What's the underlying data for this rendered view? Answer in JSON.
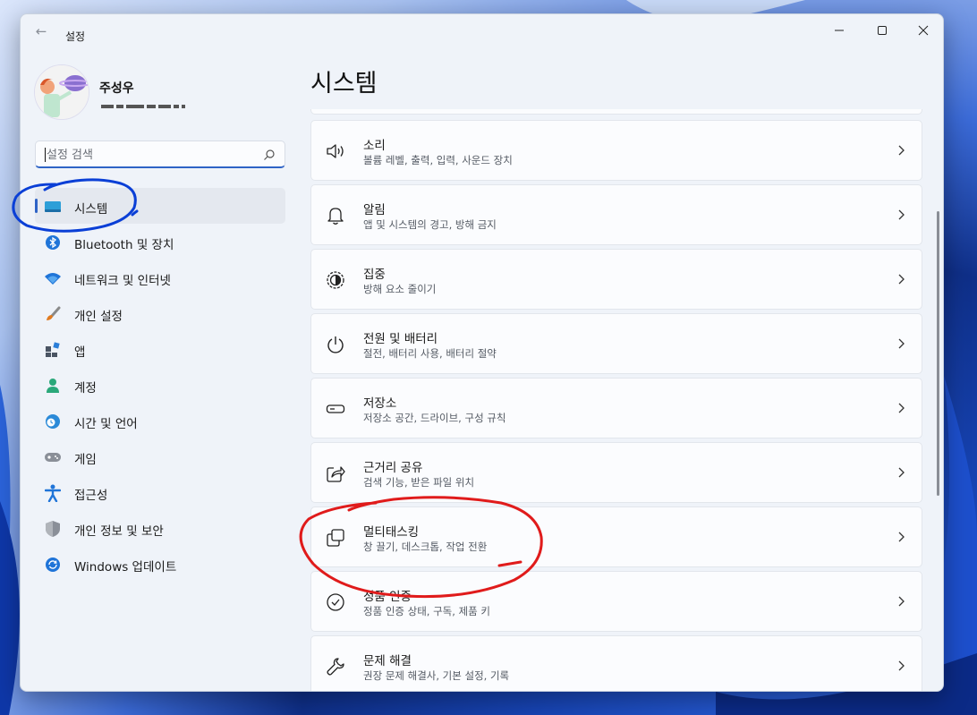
{
  "window": {
    "app_title": "설정",
    "back_label": "←"
  },
  "profile": {
    "name": "주성우"
  },
  "search": {
    "placeholder": "설정 검색"
  },
  "nav": {
    "items": [
      {
        "label": "시스템",
        "icon": "system-icon",
        "selected": true
      },
      {
        "label": "Bluetooth 및 장치",
        "icon": "bluetooth-icon"
      },
      {
        "label": "네트워크 및 인터넷",
        "icon": "wifi-icon"
      },
      {
        "label": "개인 설정",
        "icon": "brush-icon"
      },
      {
        "label": "앱",
        "icon": "apps-icon"
      },
      {
        "label": "계정",
        "icon": "account-icon"
      },
      {
        "label": "시간 및 언어",
        "icon": "globe-clock-icon"
      },
      {
        "label": "게임",
        "icon": "gamepad-icon"
      },
      {
        "label": "접근성",
        "icon": "accessibility-icon"
      },
      {
        "label": "개인 정보 및 보안",
        "icon": "shield-icon"
      },
      {
        "label": "Windows 업데이트",
        "icon": "update-icon"
      }
    ]
  },
  "page": {
    "title": "시스템"
  },
  "cards": [
    {
      "title": "소리",
      "subtitle": "볼륨 레벨, 출력, 입력, 사운드 장치",
      "icon": "speaker-icon"
    },
    {
      "title": "알림",
      "subtitle": "앱 및 시스템의 경고, 방해 금지",
      "icon": "bell-icon"
    },
    {
      "title": "집중",
      "subtitle": "방해 요소 줄이기",
      "icon": "focus-icon"
    },
    {
      "title": "전원 및 배터리",
      "subtitle": "절전, 배터리 사용, 배터리 절약",
      "icon": "power-icon"
    },
    {
      "title": "저장소",
      "subtitle": "저장소 공간, 드라이브, 구성 규칙",
      "icon": "storage-icon"
    },
    {
      "title": "근거리 공유",
      "subtitle": "검색 기능, 받은 파일 위치",
      "icon": "share-icon"
    },
    {
      "title": "멀티태스킹",
      "subtitle": "창 끌기, 데스크톱, 작업 전환",
      "icon": "multitask-icon"
    },
    {
      "title": "정품 인증",
      "subtitle": "정품 인증 상태, 구독, 제품 키",
      "icon": "activation-icon"
    },
    {
      "title": "문제 해결",
      "subtitle": "권장 문제 해결사, 기본 설정, 기록",
      "icon": "wrench-icon"
    }
  ],
  "colors": {
    "accent": "#2e63c6",
    "annotation_blue": "#0a3fd6",
    "annotation_red": "#e01b1b"
  }
}
